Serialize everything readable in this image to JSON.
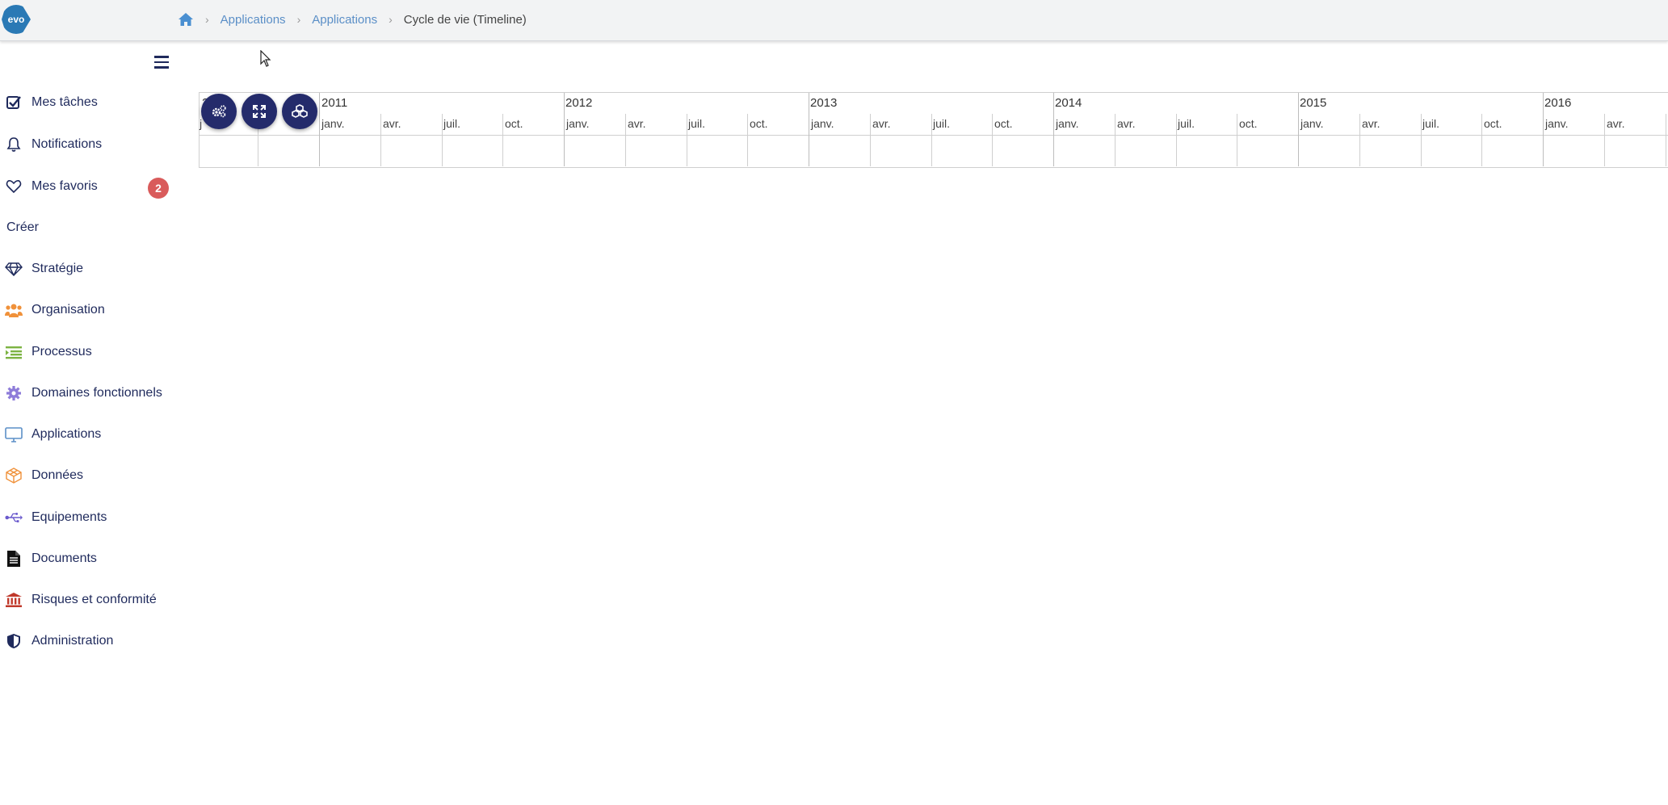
{
  "app": {
    "logo_text": "evo"
  },
  "breadcrumb": {
    "items": [
      "Applications",
      "Applications"
    ],
    "current": "Cycle de vie (Timeline)"
  },
  "sidebar": {
    "items": [
      {
        "label": "Mes tâches",
        "icon": "checkbox-icon"
      },
      {
        "label": "Notifications",
        "icon": "bell-icon"
      },
      {
        "label": "Mes favoris",
        "icon": "heart-icon",
        "badge": "2"
      },
      {
        "label": "Créer",
        "icon": null
      },
      {
        "label": "Stratégie",
        "icon": "diamond-icon"
      },
      {
        "label": "Organisation",
        "icon": "users-icon"
      },
      {
        "label": "Processus",
        "icon": "process-list-icon"
      },
      {
        "label": "Domaines fonctionnels",
        "icon": "cog-icon"
      },
      {
        "label": "Applications",
        "icon": "monitor-icon"
      },
      {
        "label": "Données",
        "icon": "data-cube-icon"
      },
      {
        "label": "Equipements",
        "icon": "usb-icon"
      },
      {
        "label": "Documents",
        "icon": "document-icon"
      },
      {
        "label": "Risques et conformité",
        "icon": "bank-icon"
      },
      {
        "label": "Administration",
        "icon": "shield-icon"
      }
    ]
  },
  "timeline": {
    "years": [
      "2011",
      "2012",
      "2013",
      "2014",
      "2015",
      "2016"
    ],
    "months": [
      "janv.",
      "avr.",
      "juil.",
      "oct."
    ],
    "partial_months": [
      "j",
      "...."
    ]
  },
  "colors": {
    "accent": "#242b6b",
    "link": "#5b8fc7",
    "badge": "#d95b5b",
    "nav_text": "#1f2a5c"
  }
}
